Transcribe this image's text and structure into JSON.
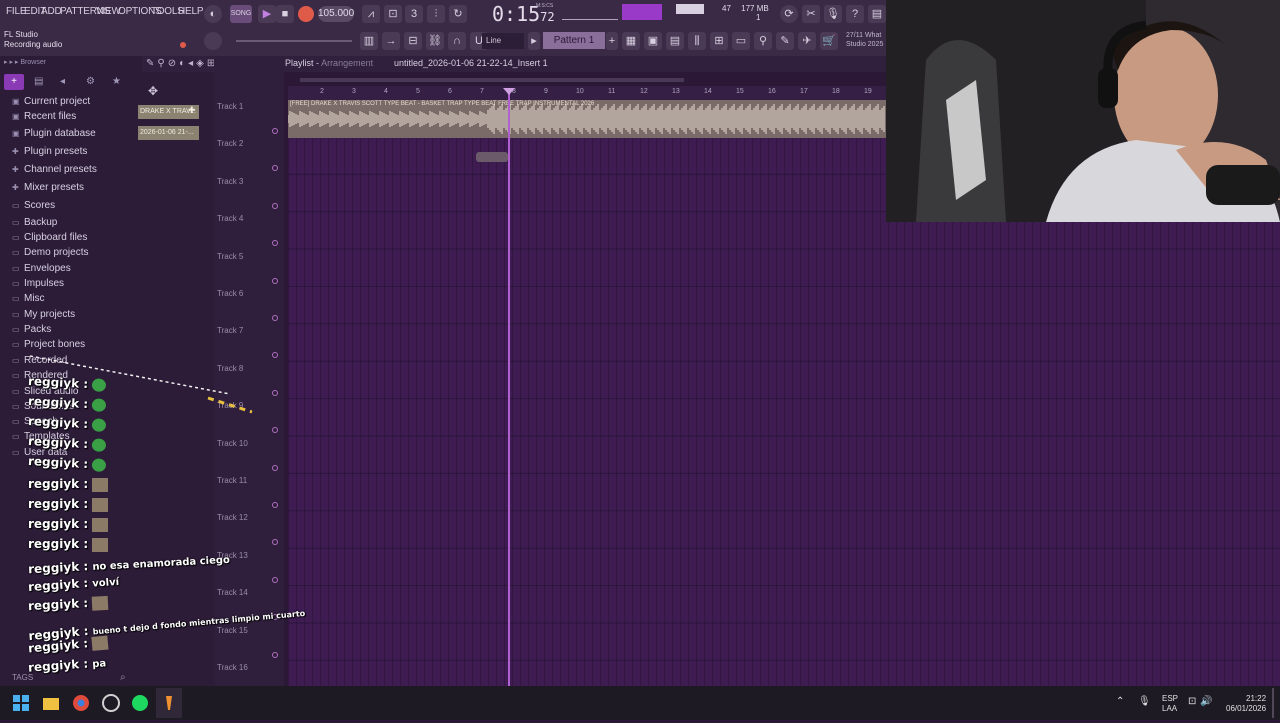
{
  "menu": [
    "FILE",
    "EDIT",
    "ADD",
    "PATTERNS",
    "VIEW",
    "OPTIONS",
    "TOOLS",
    "HELP"
  ],
  "transport": {
    "tempo": "105.000",
    "time": "0:15",
    "time_sub": "72",
    "time_unit": "M:S:CS",
    "pattern": "Pattern 1",
    "snap": "Line"
  },
  "hint": {
    "app": "FL Studio",
    "status": "Recording audio"
  },
  "stats": {
    "cpu": "47",
    "ram": "177 MB",
    "poly": "1"
  },
  "news": {
    "date": "27/11",
    "text": "What",
    "sub": "Studio 2025"
  },
  "browser": {
    "title": "Browser",
    "items": [
      "Current project",
      "Recent files",
      "Plugin database",
      "Plugin presets",
      "Channel presets",
      "Mixer presets",
      "Scores",
      "Backup",
      "Clipboard files",
      "Demo projects",
      "Envelopes",
      "Impulses",
      "Misc",
      "My projects",
      "Packs",
      "Project bones",
      "Recorded",
      "Rendered",
      "Sliced audio",
      "Soundfonts",
      "Speech",
      "Templates",
      "User data"
    ],
    "tags_label": "TAGS"
  },
  "playlist": {
    "title": "Playlist",
    "subtitle": "Arrangement",
    "project": "untitled_2026-01-06 21-22-14_Insert 1",
    "tracks": [
      "Track 1",
      "Track 2",
      "Track 3",
      "Track 4",
      "Track 5",
      "Track 6",
      "Track 7",
      "Track 8",
      "Track 9",
      "Track 10",
      "Track 11",
      "Track 12",
      "Track 13",
      "Track 14",
      "Track 15",
      "Track 16"
    ],
    "ruler": [
      "2",
      "3",
      "4",
      "5",
      "6",
      "7",
      "8",
      "9",
      "10",
      "11",
      "12",
      "13",
      "14",
      "15",
      "16",
      "17",
      "18",
      "19"
    ],
    "clips": [
      "DRAKE X TRAV...",
      "2026-01-06 21-..."
    ],
    "clip_label": "[FREE] DRAKE X TRAVIS SCOTT TYPE BEAT - BASKET  TRAP TYPE BEAT  FREE TRAP INSTRUMENTAL 2026"
  },
  "chat": [
    {
      "user": "reggiyk",
      "msg": "",
      "kind": "emote"
    },
    {
      "user": "reggiyk",
      "msg": "",
      "kind": "emote"
    },
    {
      "user": "reggiyk",
      "msg": "",
      "kind": "emote"
    },
    {
      "user": "reggiyk",
      "msg": "",
      "kind": "emote"
    },
    {
      "user": "reggiyk",
      "msg": "",
      "kind": "emote"
    },
    {
      "user": "reggiyk",
      "msg": "",
      "kind": "photo"
    },
    {
      "user": "reggiyk",
      "msg": "",
      "kind": "photo"
    },
    {
      "user": "reggiyk",
      "msg": "",
      "kind": "photo"
    },
    {
      "user": "reggiyk",
      "msg": "",
      "kind": "photo"
    },
    {
      "user": "reggiyk",
      "msg": "no esa enamorada ciego",
      "kind": "text"
    },
    {
      "user": "reggiyk",
      "msg": "volví",
      "kind": "text"
    },
    {
      "user": "reggiyk",
      "msg": "",
      "kind": "photo"
    },
    {
      "user": "reggiyk",
      "msg": "bueno t dejo d fondo mientras limpio mi cuarto",
      "kind": "text"
    },
    {
      "user": "reggiyk",
      "msg": "",
      "kind": "photo"
    },
    {
      "user": "reggiyk",
      "msg": "pa",
      "kind": "text"
    }
  ],
  "taskbar": {
    "lang": "ESP",
    "layout": "LAA",
    "time": "21:22",
    "date": "06/01/2026"
  },
  "colors": {
    "accent": "#b060d0",
    "grid": "#3e1c52",
    "clip": "#7a6a68",
    "record": "#e05a4a"
  }
}
